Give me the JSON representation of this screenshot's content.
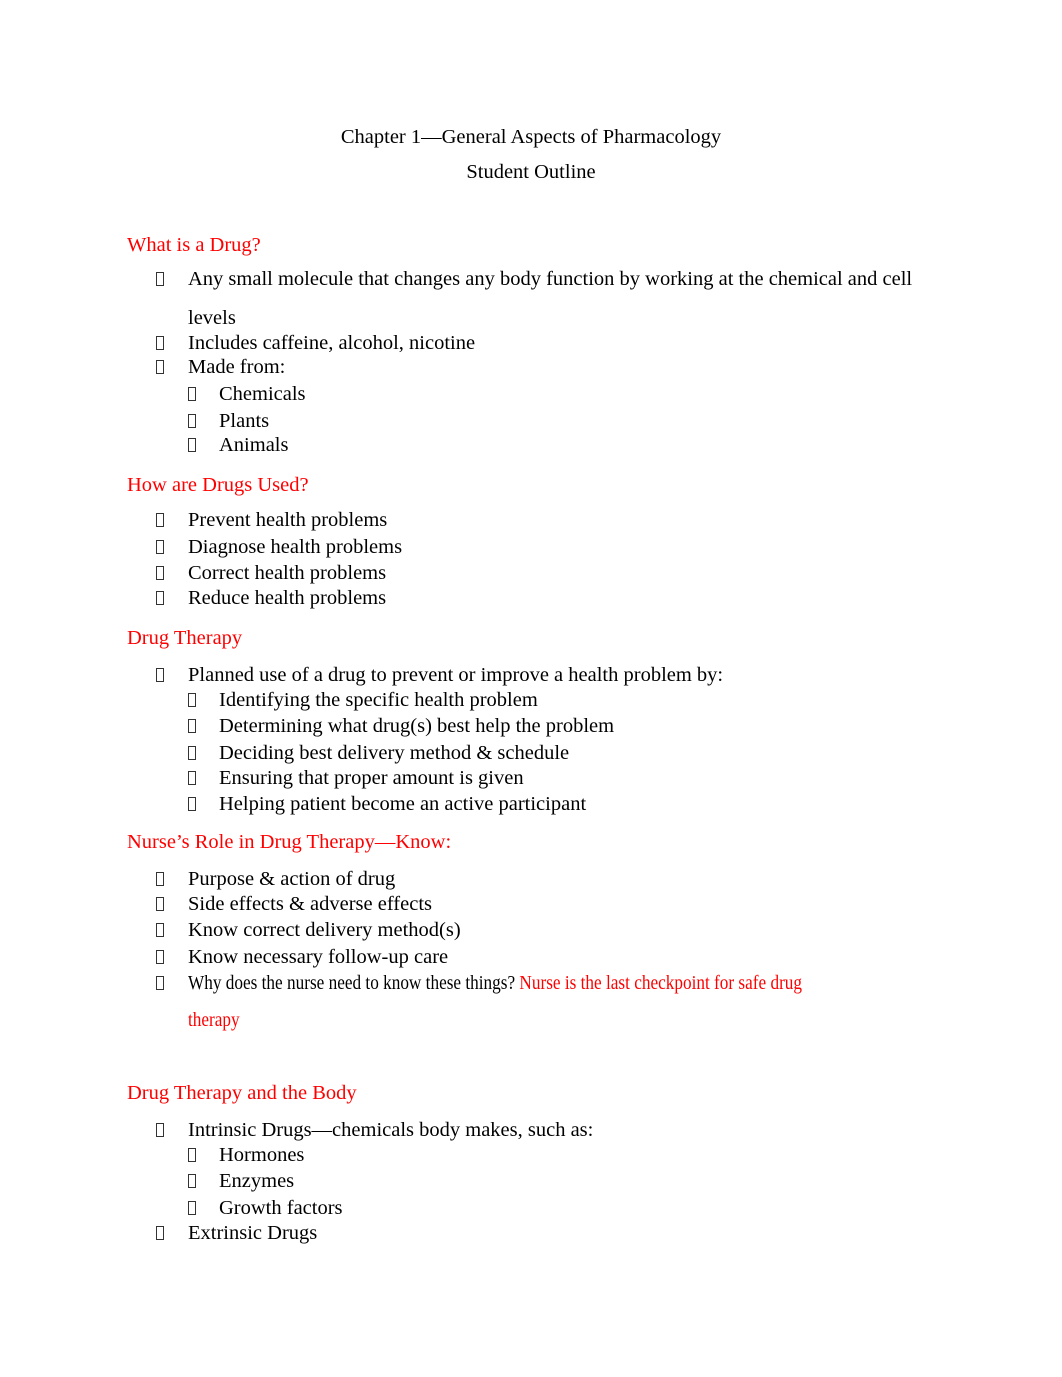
{
  "document": {
    "title": "Chapter 1—General Aspects of Pharmacology",
    "subtitle": "Student Outline",
    "bullet_icon": "missing-glyph-square",
    "accent_color": "#ff0000",
    "sections": [
      {
        "heading": "What is a Drug?",
        "items": [
          {
            "level": 1,
            "text": "Any small molecule that changes any body function by working at the chemical and cell",
            "continuation": "levels"
          },
          {
            "level": 1,
            "text": "Includes caffeine, alcohol, nicotine"
          },
          {
            "level": 1,
            "text": "Made from:"
          },
          {
            "level": 2,
            "text": "Chemicals"
          },
          {
            "level": 2,
            "text": "Plants"
          },
          {
            "level": 2,
            "text": "Animals"
          }
        ]
      },
      {
        "heading": "How are Drugs Used?",
        "items": [
          {
            "level": 1,
            "text": "Prevent health problems"
          },
          {
            "level": 1,
            "text": "Diagnose health problems"
          },
          {
            "level": 1,
            "text": "Correct health problems"
          },
          {
            "level": 1,
            "text": "Reduce health problems"
          }
        ]
      },
      {
        "heading": "Drug Therapy",
        "items": [
          {
            "level": 1,
            "text": "Planned use of a drug to prevent or improve a health problem by:"
          },
          {
            "level": 2,
            "text": "Identifying the specific health problem"
          },
          {
            "level": 2,
            "text": "Determining what drug(s) best help the problem"
          },
          {
            "level": 2,
            "text": "Deciding best delivery method & schedule"
          },
          {
            "level": 2,
            "text": "Ensuring that proper amount is given"
          },
          {
            "level": 2,
            "text": "Helping patient become an active participant"
          }
        ]
      },
      {
        "heading": "Nurse’s Role in Drug Therapy—Know:",
        "items": [
          {
            "level": 1,
            "text": "Purpose & action of drug"
          },
          {
            "level": 1,
            "text": "Side effects & adverse effects"
          },
          {
            "level": 1,
            "text": "Know correct delivery method(s)"
          },
          {
            "level": 1,
            "text": "Know necessary follow-up care"
          },
          {
            "level": 1,
            "text": "Why does the nurse need to know these things?",
            "answer": "Nurse is the last checkpoint for safe drug",
            "answer_continuation": "therapy"
          }
        ]
      },
      {
        "heading": "Drug Therapy and the Body",
        "items": [
          {
            "level": 1,
            "text": "Intrinsic Drugs—chemicals body makes, such as:"
          },
          {
            "level": 2,
            "text": "Hormones"
          },
          {
            "level": 2,
            "text": "Enzymes"
          },
          {
            "level": 2,
            "text": "Growth factors"
          },
          {
            "level": 1,
            "text": "Extrinsic Drugs"
          }
        ]
      }
    ]
  }
}
